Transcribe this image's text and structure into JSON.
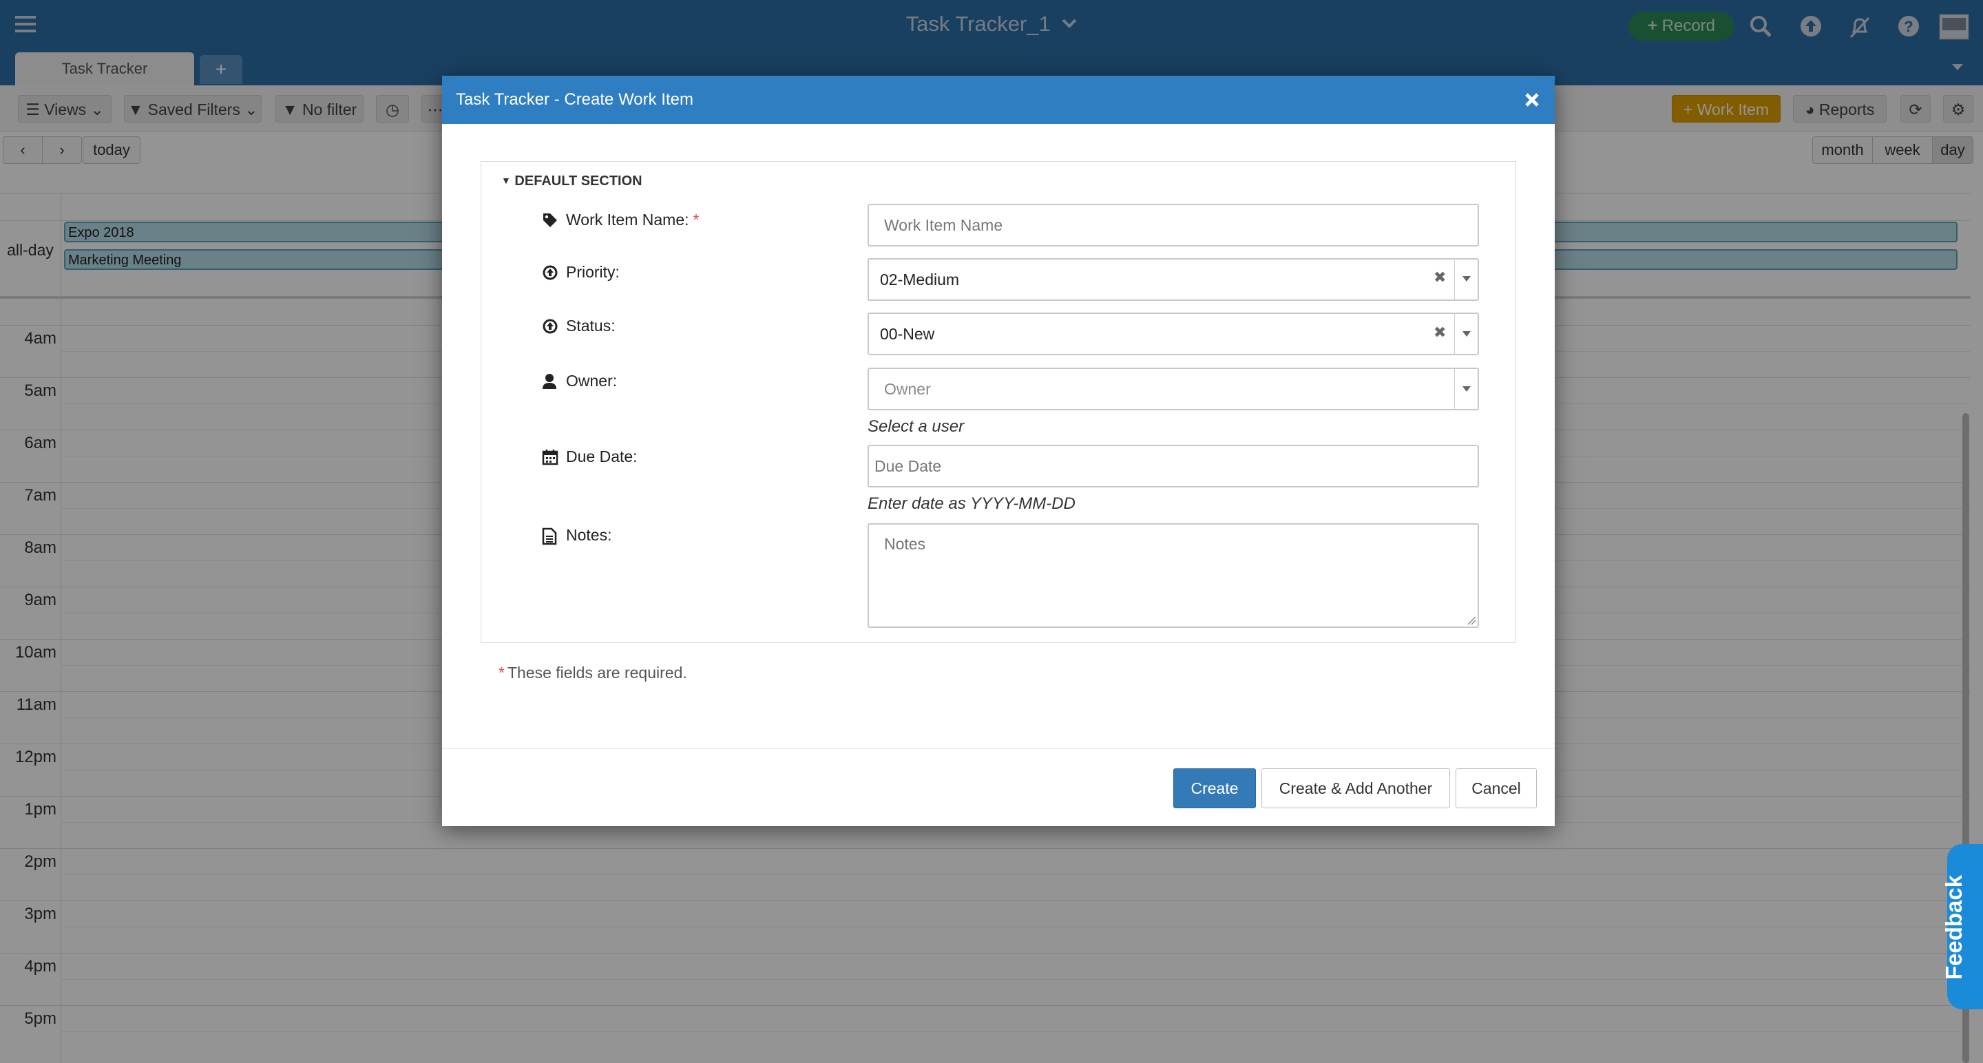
{
  "app": {
    "title": "Task Tracker_1",
    "record_label": "Record"
  },
  "tabs": {
    "items": [
      {
        "label": "Task Tracker"
      }
    ],
    "add_label": "+"
  },
  "toolbar": {
    "views_label": "Views",
    "saved_filters_label": "Saved Filters",
    "no_filter_label": "No filter",
    "work_item_label": "Work Item",
    "reports_label": "Reports"
  },
  "calendar": {
    "today_label": "today",
    "views": [
      "month",
      "week",
      "day"
    ],
    "active_view": "day",
    "all_day_label": "all-day",
    "events": [
      {
        "title": "Expo 2018"
      },
      {
        "title": "Marketing Meeting"
      }
    ],
    "hours": [
      "4am",
      "5am",
      "6am",
      "7am",
      "8am",
      "9am",
      "10am",
      "11am",
      "12pm",
      "1pm",
      "2pm",
      "3pm",
      "4pm",
      "5pm"
    ]
  },
  "modal": {
    "title": "Task Tracker - Create Work Item",
    "section_title": "DEFAULT SECTION",
    "fields": {
      "name": {
        "label": "Work Item Name:",
        "placeholder": "Work Item Name",
        "required_mark": "*"
      },
      "priority": {
        "label": "Priority:",
        "value": "02-Medium"
      },
      "status": {
        "label": "Status:",
        "value": "00-New"
      },
      "owner": {
        "label": "Owner:",
        "placeholder": "Owner",
        "help": "Select a user"
      },
      "due_date": {
        "label": "Due Date:",
        "placeholder": "Due Date",
        "help": "Enter date as YYYY-MM-DD"
      },
      "notes": {
        "label": "Notes:",
        "placeholder": "Notes"
      }
    },
    "required_mark": "*",
    "required_note": "These fields are required.",
    "buttons": {
      "create": "Create",
      "create_add_another": "Create & Add Another",
      "cancel": "Cancel"
    }
  },
  "feedback_label": "Feedback",
  "colors": {
    "app_bar": "#2e6fa8",
    "modal_header": "#2f7ec2",
    "primary_button": "#337ab7",
    "record_button": "#2e8b57",
    "work_item_button": "#e0a000",
    "feedback_tab": "#1a8bd8",
    "required": "#d9534f"
  }
}
